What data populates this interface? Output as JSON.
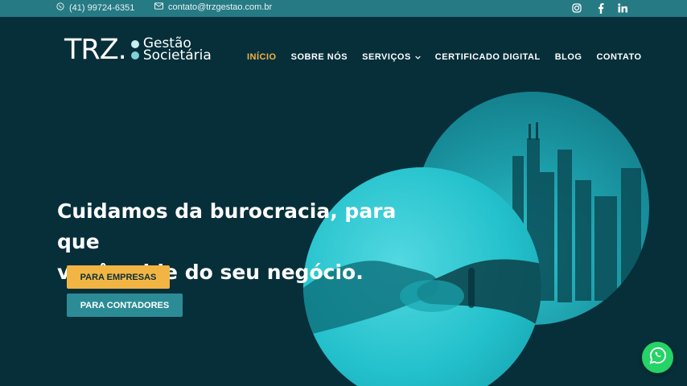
{
  "topbar": {
    "phone": "(41) 99724-6351",
    "email": "contato@trzgestao.com.br",
    "social": [
      "instagram-icon",
      "facebook-icon",
      "linkedin-icon"
    ]
  },
  "logo": {
    "mark": "TRZ.",
    "line1": "Gestão",
    "line2": "Societária"
  },
  "nav": {
    "items": [
      {
        "label": "INÍCIO",
        "active": true
      },
      {
        "label": "SOBRE NÓS"
      },
      {
        "label": "SERVIÇOS",
        "has_dropdown": true
      },
      {
        "label": "CERTIFICADO DIGITAL"
      },
      {
        "label": "BLOG"
      },
      {
        "label": "CONTATO"
      }
    ]
  },
  "hero": {
    "headline_line1": "Cuidamos da burocracia, para que",
    "headline_line2": "você cuide do seu negócio.",
    "btn_primary": "PARA EMPRESAS",
    "btn_secondary": "PARA CONTADORES"
  },
  "colors": {
    "background": "#062f3a",
    "topbar": "#267a84",
    "accent": "#f2b544",
    "secondary_button": "#2c8c96",
    "whatsapp": "#25d366"
  }
}
